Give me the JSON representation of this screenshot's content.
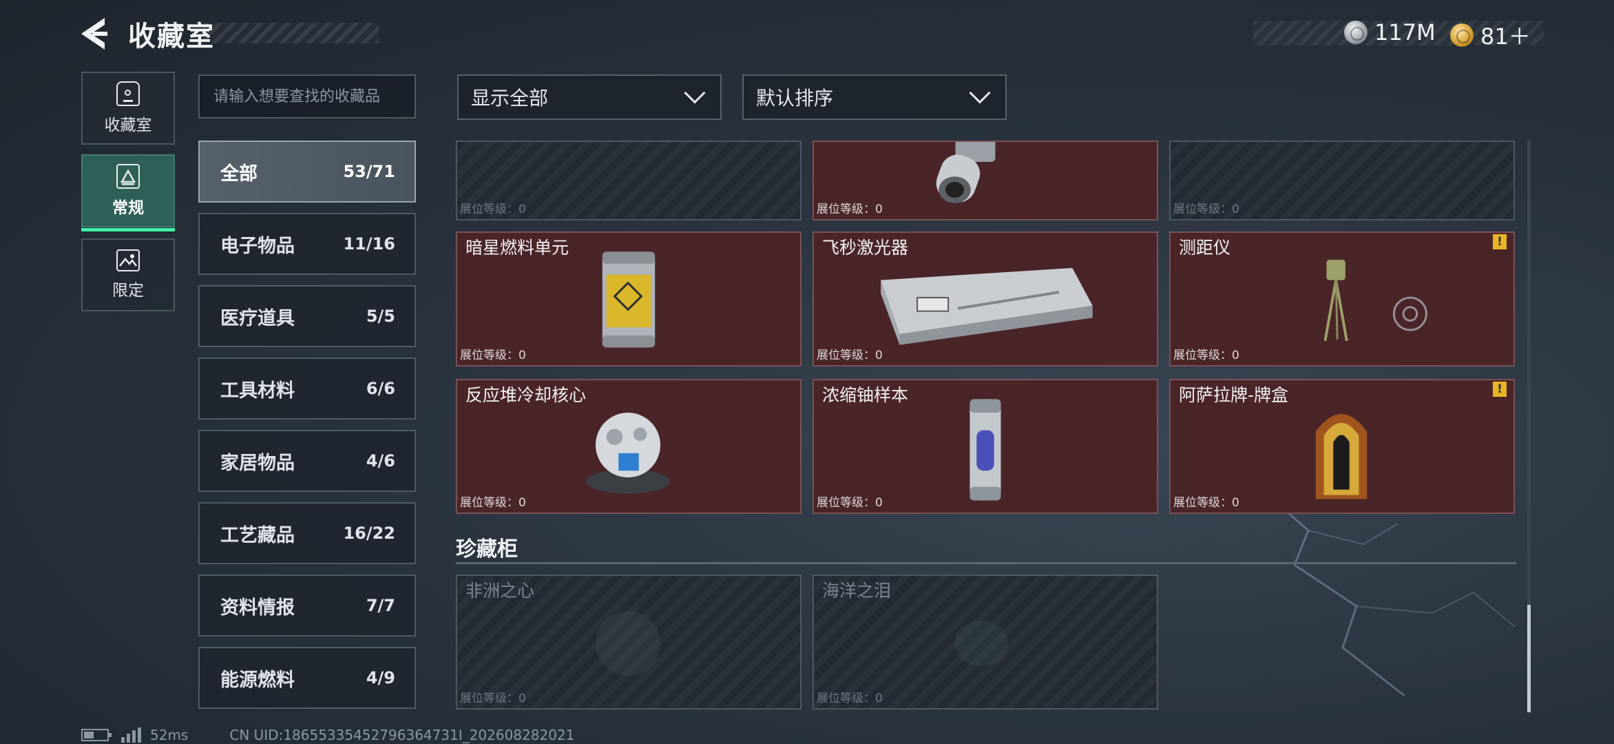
{
  "header": {
    "title": "收藏室",
    "currency_silver": "117M",
    "currency_gold": "81＋"
  },
  "rail": [
    {
      "label": "收藏室",
      "icon": "box-icon",
      "active": false
    },
    {
      "label": "常规",
      "icon": "warning-frame-icon",
      "active": true
    },
    {
      "label": "限定",
      "icon": "image-icon",
      "active": false
    }
  ],
  "search": {
    "placeholder": "请输入想要查找的收藏品"
  },
  "categories": [
    {
      "name": "全部",
      "count": "53/71",
      "active": true
    },
    {
      "name": "电子物品",
      "count": "11/16"
    },
    {
      "name": "医疗道具",
      "count": "5/5"
    },
    {
      "name": "工具材料",
      "count": "6/6"
    },
    {
      "name": "家居物品",
      "count": "4/6"
    },
    {
      "name": "工艺藏品",
      "count": "16/22"
    },
    {
      "name": "资料情报",
      "count": "7/7"
    },
    {
      "name": "能源燃料",
      "count": "4/9"
    }
  ],
  "filters": {
    "display": "显示全部",
    "sort": "默认排序"
  },
  "items_top_partial": [
    {
      "name": "",
      "level": "展位等级：0",
      "locked": true
    },
    {
      "name": "",
      "level": "展位等级：0",
      "locked": false,
      "icon": "scope-lens-icon"
    },
    {
      "name": "",
      "level": "展位等级：0",
      "locked": true
    }
  ],
  "items": [
    {
      "name": "暗星燃料单元",
      "level": "展位等级：0",
      "icon": "fuel-canister-icon",
      "warning": false
    },
    {
      "name": "飞秒激光器",
      "level": "展位等级：0",
      "icon": "laser-device-icon",
      "warning": false
    },
    {
      "name": "测距仪",
      "level": "展位等级：0",
      "icon": "rangefinder-tripod-icon",
      "warning": true
    },
    {
      "name": "反应堆冷却核心",
      "level": "展位等级：0",
      "icon": "reactor-core-icon",
      "warning": false
    },
    {
      "name": "浓缩铀样本",
      "level": "展位等级：0",
      "icon": "uranium-capsule-icon",
      "warning": false
    },
    {
      "name": "阿萨拉牌-牌盒",
      "level": "展位等级：0",
      "icon": "card-box-icon",
      "warning": true
    }
  ],
  "showcase": {
    "title": "珍藏柜",
    "items": [
      {
        "name": "非洲之心",
        "level": "展位等级：0",
        "locked": true
      },
      {
        "name": "海洋之泪",
        "level": "展位等级：0",
        "locked": true
      }
    ]
  },
  "footer": {
    "ping": "52ms",
    "uid": "CN UID:18655335452796364731I_202608282021"
  },
  "colors": {
    "item_bg": "#4a2528",
    "active_tab": "#2f6058",
    "active_accent": "#3ff2a6",
    "warning": "#e9b526"
  }
}
